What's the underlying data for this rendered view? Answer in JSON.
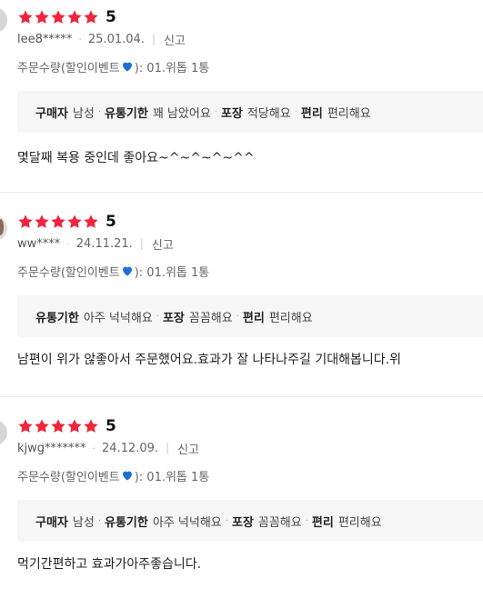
{
  "reviews": [
    {
      "score": "5",
      "user": "lee8*****",
      "date": "25.01.04.",
      "report": "신고",
      "option_prefix": "주문수량(할인이벤트",
      "option_suffix": "): 01.위톱 1통",
      "tags": [
        {
          "key": "구매자",
          "val": "남성"
        },
        {
          "key": "유통기한",
          "val": "꽤 남았어요"
        },
        {
          "key": "포장",
          "val": "적당해요"
        },
        {
          "key": "편리",
          "val": "편리해요"
        }
      ],
      "body": "몇달째 복용 중인데 좋아요~^~^~^~^^"
    },
    {
      "score": "5",
      "user": "ww****",
      "date": "24.11.21.",
      "report": "신고",
      "option_prefix": "주문수량(할인이벤트",
      "option_suffix": "): 01.위톱 1통",
      "tags": [
        {
          "key": "유통기한",
          "val": "아주 넉넉해요"
        },
        {
          "key": "포장",
          "val": "꼼꼼해요"
        },
        {
          "key": "편리",
          "val": "편리해요"
        }
      ],
      "body": "남편이 위가 않좋아서 주문했어요.효과가 잘 나타나주길 기대해봅니다.위"
    },
    {
      "score": "5",
      "user": "kjwg*******",
      "date": "24.12.09.",
      "report": "신고",
      "option_prefix": "주문수량(할인이벤트",
      "option_suffix": "): 01.위톱 1통",
      "tags": [
        {
          "key": "구매자",
          "val": "남성"
        },
        {
          "key": "유통기한",
          "val": "아주 넉넉해요"
        },
        {
          "key": "포장",
          "val": "꼼꼼해요"
        },
        {
          "key": "편리",
          "val": "편리해요"
        }
      ],
      "body": "먹기간편하고 효과가아주좋습니다."
    }
  ],
  "rating_stars": 5,
  "colors": {
    "star": "#f0243a",
    "heart": "#1e6fd0",
    "tag_bg": "#f6f6f6",
    "divider": "#e8e8e8"
  },
  "icons": {
    "star": "star-icon",
    "heart": "blue-heart-icon"
  }
}
